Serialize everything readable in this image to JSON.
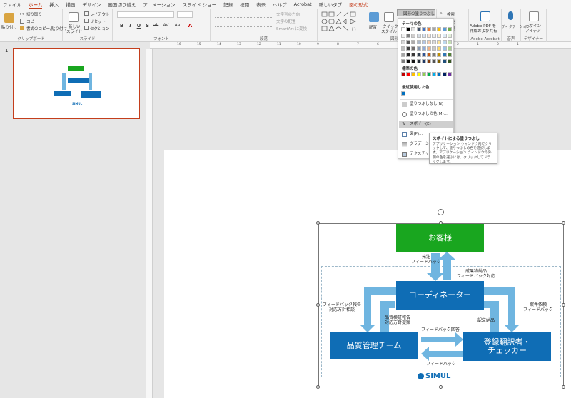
{
  "menu": {
    "tabs": [
      "ファイル",
      "ホーム",
      "挿入",
      "描画",
      "デザイン",
      "画面切り替え",
      "アニメーション",
      "スライド ショー",
      "記録",
      "校閲",
      "表示",
      "ヘルプ",
      "Acrobat",
      "新しいタブ",
      "図の形式"
    ]
  },
  "ribbon": {
    "clipboard": {
      "paste": "貼り付け",
      "cut": "切り取り",
      "copy": "コピー",
      "format_painter": "書式のコピー/貼り付け",
      "label": "クリップボード"
    },
    "slides": {
      "new_slide_1": "新しい",
      "new_slide_2": "スライド",
      "layout": "レイアウト",
      "reset": "リセット",
      "section": "セクション",
      "label": "スライド"
    },
    "font": {
      "label": "フォント",
      "buttons": [
        "B",
        "I",
        "U",
        "S",
        "ab",
        "AV",
        "Aa",
        "A"
      ]
    },
    "paragraph": {
      "text_direction": "文字列の方向",
      "align_text": "文字の配置",
      "smartart": "SmartArt に変換",
      "label": "段落"
    },
    "drawing": {
      "arrange": "配置",
      "quick_styles_1": "クイック",
      "quick_styles_2": "スタイル",
      "shape_fill": "図形の塗りつぶし",
      "label": "図形描画"
    },
    "editing": {
      "find": "検索",
      "replace": "置換",
      "select": "選択"
    },
    "adobe": {
      "pdf_1": "Adobe PDF を",
      "pdf_2": "作成および共有",
      "label": "Adobe Acrobat"
    },
    "voice": {
      "dictate": "ディクテーション",
      "label": "音声"
    },
    "designer": {
      "design_ideas_1": "デザイン",
      "design_ideas_2": "アイデア",
      "label": "デザイナー"
    }
  },
  "slide_panel": {
    "slide_number": "1"
  },
  "ruler": {
    "ticks": [
      "16",
      "15",
      "14",
      "13",
      "12",
      "11",
      "10",
      "9",
      "8",
      "7",
      "6",
      "5",
      "4",
      "3",
      "2",
      "1",
      "0",
      "1"
    ]
  },
  "dropdown": {
    "theme_colors_title": "テーマの色",
    "standard_colors_title": "標準の色",
    "recent_colors_title": "最近使用した色",
    "no_fill": "塗りつぶしなし(N)",
    "more_colors": "塗りつぶしの色(M)...",
    "eyedropper": "スポイト(E)",
    "picture": "図(P)...",
    "gradient": "グラデーション",
    "texture": "テクスチャ(T)",
    "theme_row_top": [
      "#ffffff",
      "#000000",
      "#e7e6e6",
      "#44546a",
      "#4472c4",
      "#ed7d31",
      "#a5a5a5",
      "#ffc000",
      "#5b9bd5",
      "#70ad47"
    ],
    "theme_shades": [
      [
        "#f2f2f2",
        "#7f7f7f",
        "#d0cece",
        "#d6dce4",
        "#d9e2f3",
        "#fbe5d5",
        "#ededed",
        "#fff2cc",
        "#deebf6",
        "#e2efd9"
      ],
      [
        "#d8d8d8",
        "#595959",
        "#aeabab",
        "#adb9ca",
        "#b4c6e7",
        "#f7cbac",
        "#dbdbdb",
        "#fee599",
        "#bdd7ee",
        "#c5e0b3"
      ],
      [
        "#bfbfbf",
        "#3f3f3f",
        "#757070",
        "#8496b0",
        "#8eaadb",
        "#f4b183",
        "#c9c9c9",
        "#ffd965",
        "#9cc3e5",
        "#a8d08d"
      ],
      [
        "#a5a5a5",
        "#262626",
        "#3a3838",
        "#323f4f",
        "#2f5496",
        "#c55a11",
        "#7b7b7b",
        "#bf9000",
        "#2e75b5",
        "#538135"
      ],
      [
        "#7f7f7f",
        "#0c0c0c",
        "#171616",
        "#222a35",
        "#1f3864",
        "#833c0b",
        "#525252",
        "#7f6000",
        "#1f4e79",
        "#375623"
      ]
    ],
    "standard": [
      "#c00000",
      "#ff0000",
      "#ffc000",
      "#ffff00",
      "#92d050",
      "#00b050",
      "#00b0f0",
      "#0070c0",
      "#002060",
      "#7030a0"
    ],
    "recent": [
      "#0070c0"
    ]
  },
  "tooltip": {
    "title": "スポイトによる塗りつぶし",
    "body": "アプリケーション ウィンドウ内でクリックして、塗りつぶしの色を選択します。アプリケーション ウィンドウの外側の色を選ぶには、クリックしてドラッグします。"
  },
  "diagram": {
    "customer": "お客様",
    "coordinator": "コーディネーター",
    "qc_team": "品質管理チーム",
    "translator_1": "登録翻訳者・",
    "translator_2": "チェッカー",
    "lbl_order_1": "発注",
    "lbl_order_2": "フィードバック",
    "lbl_deliver_1": "成果物納品",
    "lbl_deliver_2": "フィードバック対応",
    "lbl_fb_report_1": "フィードバック報告",
    "lbl_fb_report_2": "対応方針相談",
    "lbl_request_1": "案件依頼",
    "lbl_request_2": "フィードバック",
    "lbl_qc_1": "品質検証報告",
    "lbl_qc_2": "対応方針提案",
    "lbl_translation": "訳文納品",
    "lbl_fb_answer": "フィードバック回答",
    "lbl_fb_bottom": "フィードバック",
    "logo": "SIMUL",
    "green": "#19a61f",
    "blue": "#0f6db5",
    "arrow": "#6fb5e0"
  }
}
